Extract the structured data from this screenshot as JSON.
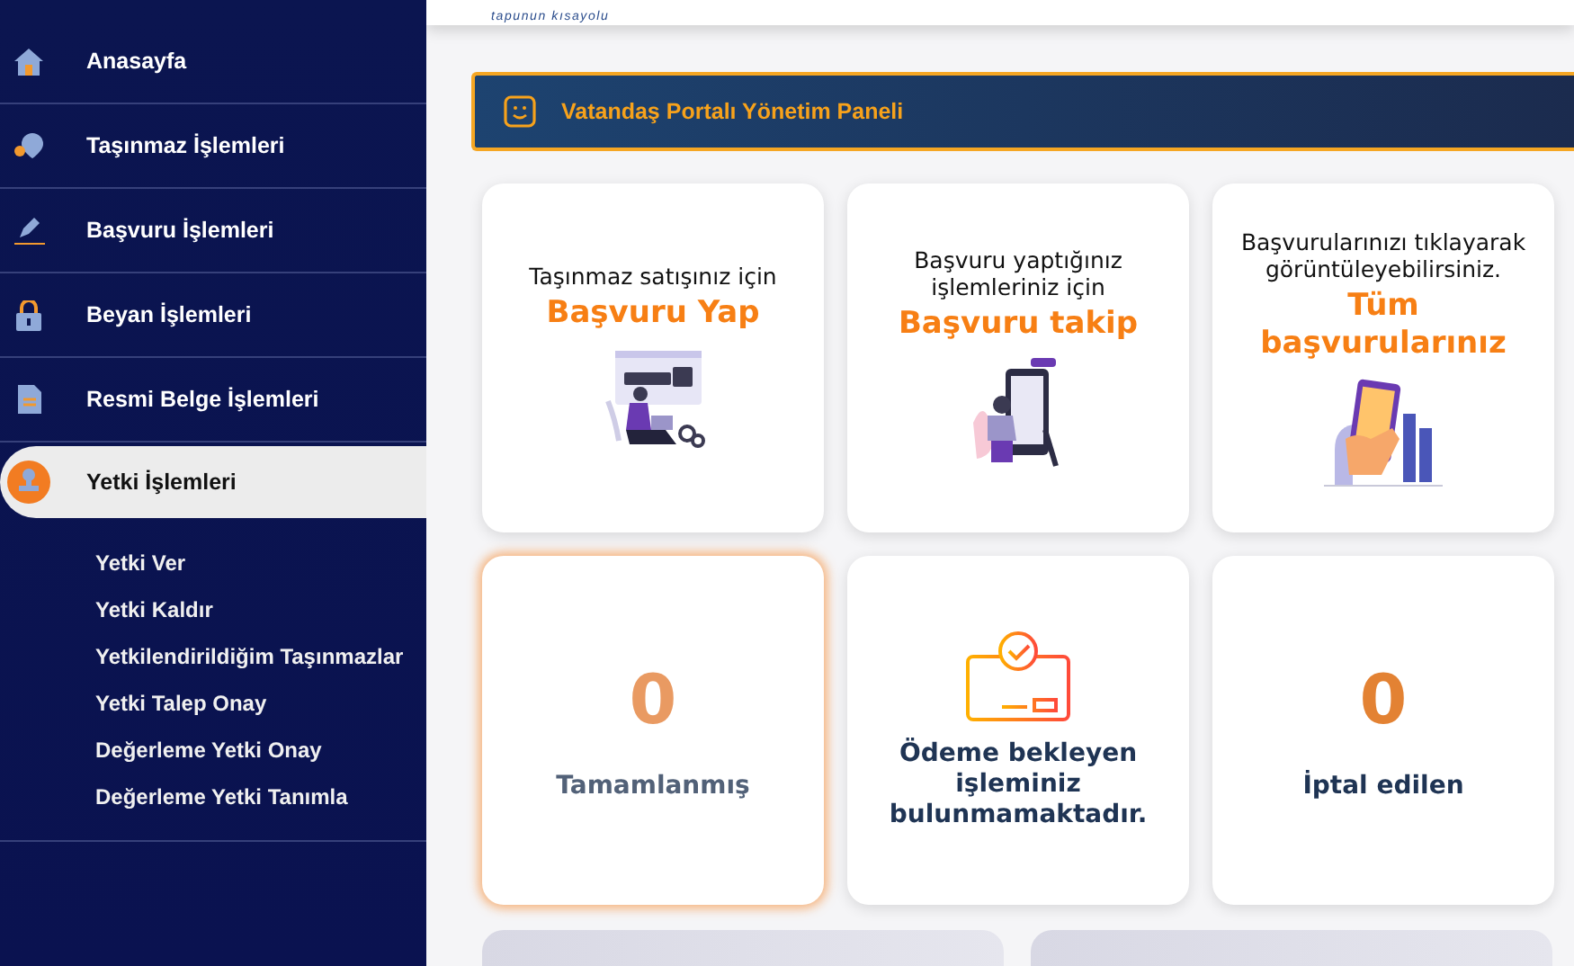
{
  "sidebar": {
    "items": [
      {
        "label": "Anasayfa",
        "selected": false
      },
      {
        "label": "Taşınmaz İşlemleri",
        "selected": false
      },
      {
        "label": "Başvuru İşlemleri",
        "selected": false
      },
      {
        "label": "Beyan İşlemleri",
        "selected": false
      },
      {
        "label": "Resmi Belge İşlemleri",
        "selected": false
      },
      {
        "label": "Yetki İşlemleri",
        "selected": true,
        "children": [
          {
            "label": "Yetki Ver"
          },
          {
            "label": "Yetki Kaldır"
          },
          {
            "label": "Yetkilendirildiğim Taşınmazlar"
          },
          {
            "label": "Yetki Talep Onay"
          },
          {
            "label": "Değerleme Yetki Onay"
          },
          {
            "label": "Değerleme Yetki Tanımla"
          }
        ]
      }
    ]
  },
  "header": {
    "logo_tagline": "tapunun kısayolu"
  },
  "banner": {
    "title": "Vatandaş Portalı Yönetim Paneli"
  },
  "tiles": [
    {
      "kind": "action",
      "text": "Taşınmaz satışınız için",
      "title": "Başvuru Yap"
    },
    {
      "kind": "action",
      "text": "Başvuru yaptığınız işlemleriniz için",
      "title": "Başvuru takip"
    },
    {
      "kind": "action",
      "text": "Başvurularınızı tıklayarak görüntüleyebilirsiniz.",
      "title": "Tüm başvurularınız"
    },
    {
      "kind": "count",
      "value": "0",
      "label": "Tamamlanmış",
      "selected": true
    },
    {
      "kind": "info",
      "text": "Ödeme bekleyen işleminiz bulunmamaktadır."
    },
    {
      "kind": "count",
      "value": "0",
      "label": "İptal edilen",
      "selected": false
    }
  ]
}
